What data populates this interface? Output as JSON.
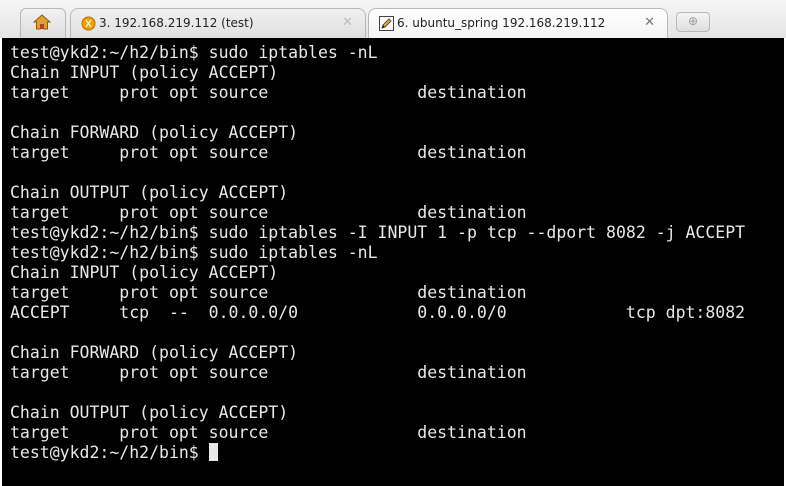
{
  "tabs": [
    {
      "title": "3. 192.168.219.112 (test)",
      "icon": "status-dot-icon",
      "icon_color": "#f0a000",
      "active": false,
      "close_glyph": "✕"
    },
    {
      "title": "6. ubuntu_spring 192.168.219.112",
      "icon": "pencil-icon",
      "active": true,
      "close_glyph": "✕"
    }
  ],
  "new_tab_glyph": "⊕",
  "terminal": {
    "background": "#000000",
    "foreground": "#e8e8e8",
    "lines": [
      "test@ykd2:~/h2/bin$ sudo iptables -nL",
      "Chain INPUT (policy ACCEPT)",
      "target     prot opt source               destination",
      "",
      "Chain FORWARD (policy ACCEPT)",
      "target     prot opt source               destination",
      "",
      "Chain OUTPUT (policy ACCEPT)",
      "target     prot opt source               destination",
      "test@ykd2:~/h2/bin$ sudo iptables -I INPUT 1 -p tcp --dport 8082 -j ACCEPT",
      "test@ykd2:~/h2/bin$ sudo iptables -nL",
      "Chain INPUT (policy ACCEPT)",
      "target     prot opt source               destination",
      "ACCEPT     tcp  --  0.0.0.0/0            0.0.0.0/0            tcp dpt:8082",
      "",
      "Chain FORWARD (policy ACCEPT)",
      "target     prot opt source               destination",
      "",
      "Chain OUTPUT (policy ACCEPT)",
      "target     prot opt source               destination"
    ],
    "prompt": "test@ykd2:~/h2/bin$ "
  }
}
